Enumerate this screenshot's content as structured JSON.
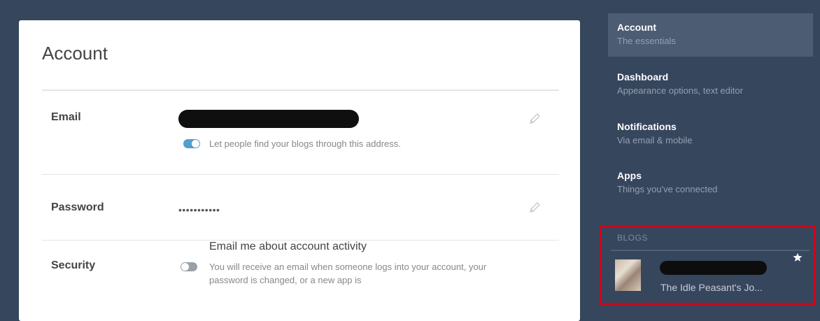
{
  "account": {
    "title": "Account",
    "email": {
      "label": "Email",
      "toggle_on": true,
      "toggle_label": "Let people find your blogs through this address."
    },
    "password": {
      "label": "Password",
      "value": "•••••••••••"
    },
    "security": {
      "label": "Security",
      "toggle_on": false,
      "toggle_label": "Email me about account activity",
      "description": "You will receive an email when someone logs into your account, your password is changed, or a new app is"
    }
  },
  "sidebar": {
    "items": [
      {
        "title": "Account",
        "subtitle": "The essentials",
        "active": true
      },
      {
        "title": "Dashboard",
        "subtitle": "Appearance options, text editor",
        "active": false
      },
      {
        "title": "Notifications",
        "subtitle": "Via email & mobile",
        "active": false
      },
      {
        "title": "Apps",
        "subtitle": "Things you've connected",
        "active": false
      }
    ],
    "blogs": {
      "label": "BLOGS",
      "items": [
        {
          "name": "The Idle Peasant's Jo...",
          "icon": "star-icon"
        }
      ]
    }
  },
  "colors": {
    "background": "#36465d",
    "accent": "#529ecc",
    "highlight": "#d0021b"
  }
}
